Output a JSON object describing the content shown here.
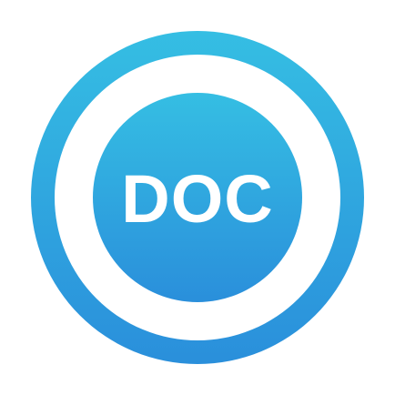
{
  "icon": {
    "name": "doc-app-icon",
    "label": "DOC",
    "colors": {
      "gradient_top": "#35BEE3",
      "gradient_bottom": "#2A8FDB",
      "ring_gap": "#FFFFFF",
      "label": "#FFFFFF",
      "background": "#FFFFFF"
    }
  }
}
